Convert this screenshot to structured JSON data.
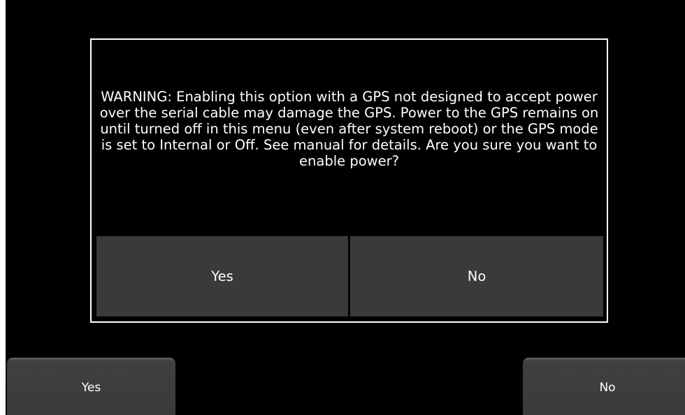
{
  "dialog": {
    "message": "WARNING: Enabling this option with a GPS not designed to accept power over the serial cable may damage the GPS. Power to the GPS remains on until turned off in this menu (even after system reboot) or the GPS mode is set to Internal or Off. See manual for details. Are you sure you want to enable power?",
    "yes_label": "Yes",
    "no_label": "No"
  },
  "softkeys": {
    "left_label": "Yes",
    "right_label": "No"
  },
  "colors": {
    "background": "#000000",
    "button": "#3a3a3a",
    "text": "#ffffff",
    "border": "#ffffff"
  }
}
